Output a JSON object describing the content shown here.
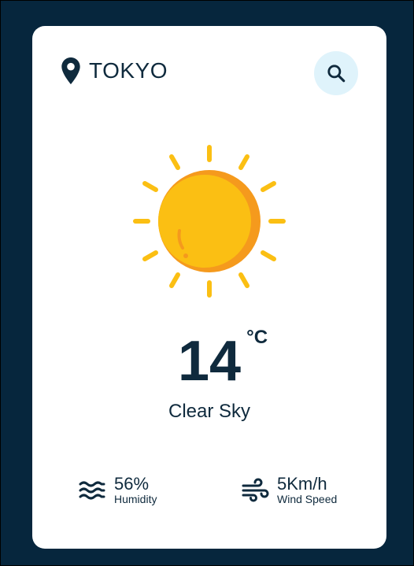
{
  "location": {
    "city": "TOKYO",
    "icon": "map-pin-icon"
  },
  "search": {
    "icon": "search-icon"
  },
  "weather": {
    "icon": "sun-icon",
    "temperature": "14",
    "unit": "°C",
    "description": "Clear Sky"
  },
  "stats": {
    "humidity": {
      "value": "56%",
      "label": "Humidity",
      "icon": "waves-icon"
    },
    "wind": {
      "value": "5Km/h",
      "label": "Wind Speed",
      "icon": "wind-icon"
    }
  },
  "colors": {
    "background": "#06263d",
    "card": "#ffffff",
    "text": "#0f2a3d",
    "search_bg": "#dff3fb",
    "sun": "#fbbf13",
    "sun_shadow": "#f59a1d"
  }
}
